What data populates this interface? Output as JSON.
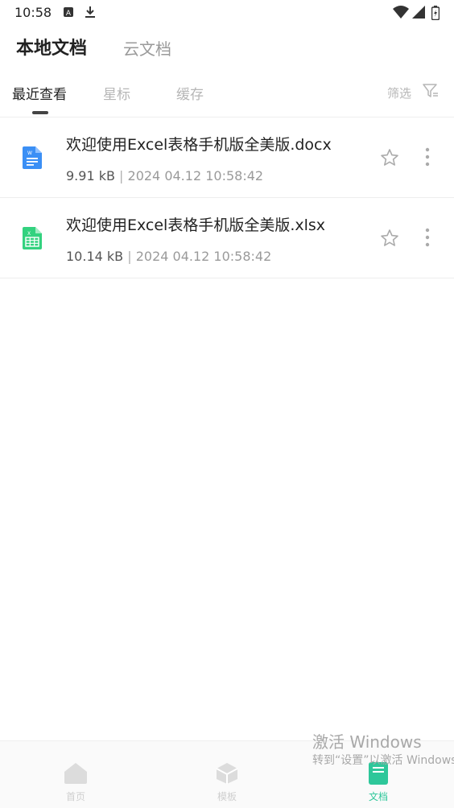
{
  "status_bar": {
    "time": "10:58",
    "left_icons": [
      "app-a-icon",
      "download-icon"
    ],
    "right_icons": [
      "wifi-icon",
      "signal-icon",
      "battery-charging-icon"
    ]
  },
  "header": {
    "tabs": [
      {
        "label": "本地文档",
        "active": true
      },
      {
        "label": "云文档",
        "active": false
      }
    ]
  },
  "sub_tabs": [
    {
      "label": "最近查看",
      "active": true
    },
    {
      "label": "星标",
      "active": false
    },
    {
      "label": "缓存",
      "active": false
    }
  ],
  "filter": {
    "label": "筛选",
    "icon": "filter-icon"
  },
  "files": [
    {
      "name": "欢迎使用Excel表格手机版全美版.docx",
      "size": "9.91 kB",
      "separator": " | ",
      "date": "2024 04.12 10:58:42",
      "icon": "word-doc-icon",
      "starred": false
    },
    {
      "name": "欢迎使用Excel表格手机版全美版.xlsx",
      "size": "10.14 kB",
      "separator": " | ",
      "date": "2024 04.12 10:58:42",
      "icon": "excel-sheet-icon",
      "starred": false
    }
  ],
  "bottom_nav": [
    {
      "label": "首页",
      "icon": "home-icon",
      "active": false
    },
    {
      "label": "模板",
      "icon": "template-cube-icon",
      "active": false
    },
    {
      "label": "文档",
      "icon": "document-icon",
      "active": true
    }
  ],
  "watermark": {
    "title": "激活 Windows",
    "subtitle": "转到“设置”以激活 Windows。"
  },
  "colors": {
    "accent": "#2ec79a",
    "word_blue": "#3b8ff5",
    "excel_green": "#33d27f",
    "inactive_text": "#b6b6b6"
  }
}
